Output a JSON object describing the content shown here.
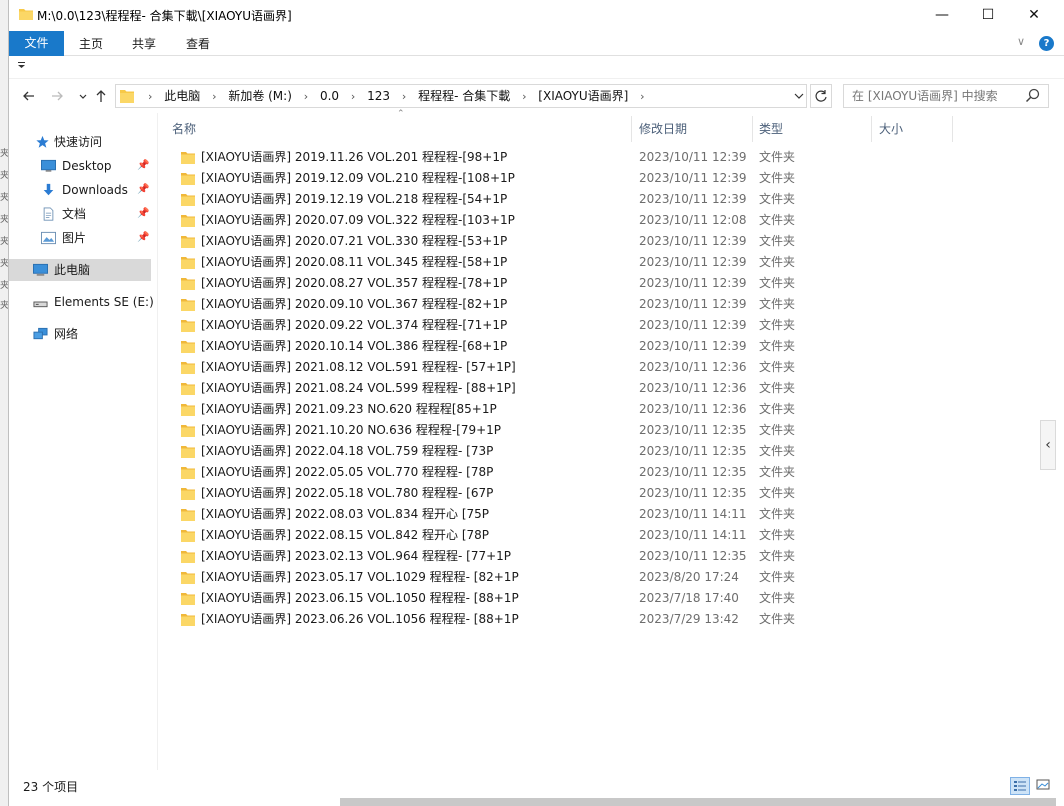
{
  "window": {
    "title": "M:\\0.0\\123\\程程程- 合集下載\\[XIAOYU语画界]",
    "minimize": "—",
    "maximize": "☐",
    "close": "✕"
  },
  "ribbon": {
    "tabs": [
      "文件",
      "主页",
      "共享",
      "查看"
    ],
    "expand": "∨",
    "help": "?"
  },
  "address": {
    "crumbs": [
      "此电脑",
      "新加卷 (M:)",
      "0.0",
      "123",
      "程程程- 合集下載",
      "[XIAOYU语画界]"
    ],
    "search_placeholder": "在 [XIAOYU语画界] 中搜索"
  },
  "sidebar": {
    "quick_access": "快速访问",
    "items": [
      {
        "label": "Desktop",
        "icon": "desktop-icon",
        "pinned": true
      },
      {
        "label": "Downloads",
        "icon": "download-icon",
        "pinned": true
      },
      {
        "label": "文档",
        "icon": "document-icon",
        "pinned": true
      },
      {
        "label": "图片",
        "icon": "picture-icon",
        "pinned": true
      }
    ],
    "this_pc": "此电脑",
    "drive": "Elements SE (E:)",
    "network": "网络"
  },
  "columns": {
    "name": "名称",
    "date": "修改日期",
    "type": "类型",
    "size": "大小"
  },
  "files": [
    {
      "name": "[XIAOYU语画界] 2019.11.26 VOL.201 程程程-[98+1P",
      "date": "2023/10/11 12:39",
      "type": "文件夹"
    },
    {
      "name": "[XIAOYU语画界] 2019.12.09 VOL.210 程程程-[108+1P",
      "date": "2023/10/11 12:39",
      "type": "文件夹"
    },
    {
      "name": "[XIAOYU语画界] 2019.12.19 VOL.218 程程程-[54+1P",
      "date": "2023/10/11 12:39",
      "type": "文件夹"
    },
    {
      "name": "[XIAOYU语画界] 2020.07.09 VOL.322 程程程-[103+1P",
      "date": "2023/10/11 12:08",
      "type": "文件夹"
    },
    {
      "name": "[XIAOYU语画界] 2020.07.21 VOL.330 程程程-[53+1P",
      "date": "2023/10/11 12:39",
      "type": "文件夹"
    },
    {
      "name": "[XIAOYU语画界] 2020.08.11 VOL.345 程程程-[58+1P",
      "date": "2023/10/11 12:39",
      "type": "文件夹"
    },
    {
      "name": "[XIAOYU语画界] 2020.08.27 VOL.357 程程程-[78+1P",
      "date": "2023/10/11 12:39",
      "type": "文件夹"
    },
    {
      "name": "[XIAOYU语画界] 2020.09.10 VOL.367 程程程-[82+1P",
      "date": "2023/10/11 12:39",
      "type": "文件夹"
    },
    {
      "name": "[XIAOYU语画界] 2020.09.22 VOL.374 程程程-[71+1P",
      "date": "2023/10/11 12:39",
      "type": "文件夹"
    },
    {
      "name": "[XIAOYU语画界] 2020.10.14 VOL.386 程程程-[68+1P",
      "date": "2023/10/11 12:39",
      "type": "文件夹"
    },
    {
      "name": "[XIAOYU语画界] 2021.08.12 VOL.591 程程程- [57+1P]",
      "date": "2023/10/11 12:36",
      "type": "文件夹"
    },
    {
      "name": "[XIAOYU语画界] 2021.08.24 VOL.599 程程程- [88+1P]",
      "date": "2023/10/11 12:36",
      "type": "文件夹"
    },
    {
      "name": "[XIAOYU语画界] 2021.09.23 NO.620 程程程[85+1P",
      "date": "2023/10/11 12:36",
      "type": "文件夹"
    },
    {
      "name": "[XIAOYU语画界] 2021.10.20 NO.636 程程程-[79+1P",
      "date": "2023/10/11 12:35",
      "type": "文件夹"
    },
    {
      "name": "[XIAOYU语画界] 2022.04.18 VOL.759 程程程- [73P",
      "date": "2023/10/11 12:35",
      "type": "文件夹"
    },
    {
      "name": "[XIAOYU语画界] 2022.05.05 VOL.770 程程程- [78P",
      "date": "2023/10/11 12:35",
      "type": "文件夹"
    },
    {
      "name": "[XIAOYU语画界] 2022.05.18 VOL.780 程程程- [67P",
      "date": "2023/10/11 12:35",
      "type": "文件夹"
    },
    {
      "name": "[XIAOYU语画界] 2022.08.03 VOL.834 程开心 [75P",
      "date": "2023/10/11 14:11",
      "type": "文件夹"
    },
    {
      "name": "[XIAOYU语画界] 2022.08.15 VOL.842 程开心 [78P",
      "date": "2023/10/11 14:11",
      "type": "文件夹"
    },
    {
      "name": "[XIAOYU语画界] 2023.02.13 VOL.964 程程程- [77+1P",
      "date": "2023/10/11 12:35",
      "type": "文件夹"
    },
    {
      "name": "[XIAOYU语画界] 2023.05.17 VOL.1029 程程程- [82+1P",
      "date": "2023/8/20 17:24",
      "type": "文件夹"
    },
    {
      "name": "[XIAOYU语画界] 2023.06.15 VOL.1050 程程程- [88+1P",
      "date": "2023/7/18 17:40",
      "type": "文件夹"
    },
    {
      "name": "[XIAOYU语画界] 2023.06.26 VOL.1056 程程程- [88+1P",
      "date": "2023/7/29 13:42",
      "type": "文件夹"
    }
  ],
  "status": {
    "count": "23 个项目"
  },
  "colors": {
    "accent": "#1979ca",
    "folder": "#f7c948",
    "selected": "#d9d9d9"
  }
}
